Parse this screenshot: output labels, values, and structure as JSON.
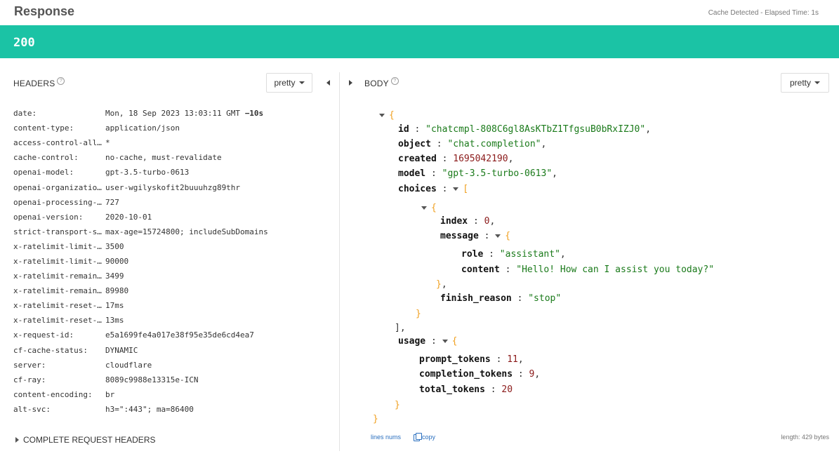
{
  "response": {
    "title": "Response",
    "cache_info": "Cache Detected - Elapsed Time: 1s",
    "status_code": "200",
    "status_color": "#1bc3a5"
  },
  "headers_panel": {
    "label": "HEADERS",
    "help_icon": "?",
    "format": "pretty",
    "rows": [
      {
        "key": "date:",
        "value": "Mon, 18 Sep 2023 13:03:11 GMT",
        "extra": "−10s"
      },
      {
        "key": "content-type:",
        "value": "application/json"
      },
      {
        "key": "access-control-all…",
        "value": "*"
      },
      {
        "key": "cache-control:",
        "value": "no-cache, must-revalidate"
      },
      {
        "key": "openai-model:",
        "value": "gpt-3.5-turbo-0613"
      },
      {
        "key": "openai-organizatio…",
        "value": "user-wgilyskofit2buuuhzg89thr"
      },
      {
        "key": "openai-processing-…",
        "value": "727"
      },
      {
        "key": "openai-version:",
        "value": "2020-10-01"
      },
      {
        "key": "strict-transport-s…",
        "value": "max-age=15724800; includeSubDomains"
      },
      {
        "key": "x-ratelimit-limit-…",
        "value": "3500"
      },
      {
        "key": "x-ratelimit-limit-…",
        "value": "90000"
      },
      {
        "key": "x-ratelimit-remain…",
        "value": "3499"
      },
      {
        "key": "x-ratelimit-remain…",
        "value": "89980"
      },
      {
        "key": "x-ratelimit-reset-…",
        "value": "17ms"
      },
      {
        "key": "x-ratelimit-reset-…",
        "value": "13ms"
      },
      {
        "key": "x-request-id:",
        "value": "e5a1699fe4a017e38f95e35de6cd4ea7"
      },
      {
        "key": "cf-cache-status:",
        "value": "DYNAMIC"
      },
      {
        "key": "server:",
        "value": "cloudflare"
      },
      {
        "key": "cf-ray:",
        "value": "8089c9988e13315e-ICN"
      },
      {
        "key": "content-encoding:",
        "value": "br"
      },
      {
        "key": "alt-svc:",
        "value": "h3=\":443\"; ma=86400"
      }
    ],
    "complete_request_headers": "COMPLETE REQUEST HEADERS"
  },
  "body_panel": {
    "label": "BODY",
    "help_icon": "?",
    "format": "pretty",
    "json": {
      "id_key": "id",
      "id_val": "\"chatcmpl-808C6gl8AsKTbZ1TfgsuB0bRxIZJ0\"",
      "object_key": "object",
      "object_val": "\"chat.completion\"",
      "created_key": "created",
      "created_val": "1695042190",
      "model_key": "model",
      "model_val": "\"gpt-3.5-turbo-0613\"",
      "choices_key": "choices",
      "index_key": "index",
      "index_val": "0",
      "message_key": "message",
      "role_key": "role",
      "role_val": "\"assistant\"",
      "content_key": "content",
      "content_val": "\"Hello! How can I assist you today?\"",
      "finish_reason_key": "finish_reason",
      "finish_reason_val": "\"stop\"",
      "usage_key": "usage",
      "prompt_tokens_key": "prompt_tokens",
      "prompt_tokens_val": "11",
      "completion_tokens_key": "completion_tokens",
      "completion_tokens_val": "9",
      "total_tokens_key": "total_tokens",
      "total_tokens_val": "20"
    },
    "lines_nums_label": "lines nums",
    "copy_label": "copy",
    "length_label": "length: 429 bytes"
  }
}
